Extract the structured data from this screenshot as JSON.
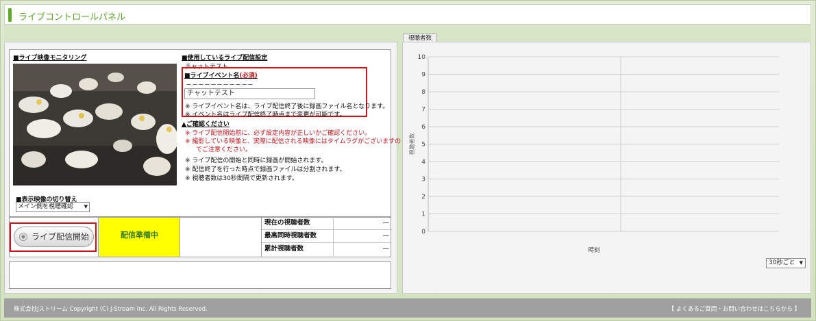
{
  "title": "ライブコントロールパネル",
  "monitor": {
    "heading": "■ライブ映像モニタリング",
    "switch_heading": "■表示映像の切り替え",
    "switch_value": "メイン側を視聴確認"
  },
  "settings": {
    "heading": "■使用しているライブ配信設定",
    "config_name": "チャットテスト",
    "event_heading": "■ライブイベント名",
    "required": "(必須)",
    "dashes": "－－－－－－－－－－－",
    "event_name": "チャットテスト",
    "notes": [
      "※ ライブイベント名は、ライブ配信終了後に録画ファイル名となります。",
      "※ イベント名はライブ配信終了時点まで変更が可能です。"
    ],
    "confirm_heading": "▲ご確認ください",
    "warnings": [
      "※ ライブ配信開始前に、必ず設定内容が正しいかご確認ください。",
      "※ 撮影している映像と、実際に配信される映像にはタイムラグがございますの",
      "でご注意ください。"
    ],
    "info": [
      "※ ライブ配信の開始と同時に録画が開始されます。",
      "※ 配信終了を行った時点で録画ファイルは分割されます。",
      "※ 視聴者数は30秒間隔で更新されます。"
    ]
  },
  "controls": {
    "start_label": "ライブ配信開始",
    "status": "配信準備中",
    "viewers": [
      {
        "label": "現在の視聴者数",
        "value": "—"
      },
      {
        "label": "最高同時視聴者数",
        "value": "—"
      },
      {
        "label": "累計視聴者数",
        "value": "—"
      }
    ]
  },
  "chart_tab": "視聴者数",
  "interval": "30秒ごと",
  "chart_data": {
    "type": "line",
    "xlabel": "時刻",
    "ylabel": "視聴者数",
    "ylim": [
      0,
      10
    ],
    "yticks": [
      "0",
      "1",
      "2",
      "3",
      "4",
      "5",
      "6",
      "7",
      "8",
      "9",
      "10"
    ],
    "x": [],
    "series": []
  },
  "footer": {
    "copyright": "株式会社Jストリーム  Copyright (C) J-Stream Inc. All Rights Reserved.",
    "faq_link": "【 よくあるご質問・お問い合わせはこちらから 】"
  }
}
